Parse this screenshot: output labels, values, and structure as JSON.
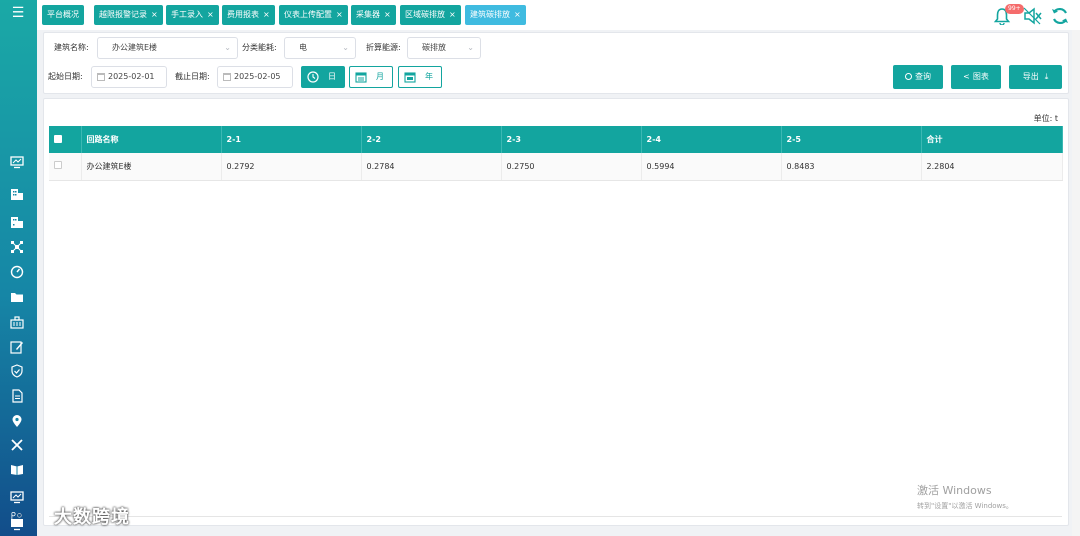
{
  "tabs": [
    {
      "label": "平台概况",
      "closable": false
    },
    {
      "label": "越限报警记录",
      "closable": true
    },
    {
      "label": "手工录入",
      "closable": true
    },
    {
      "label": "费用报表",
      "closable": true
    },
    {
      "label": "仪表上传配置",
      "closable": true
    },
    {
      "label": "采集器",
      "closable": true
    },
    {
      "label": "区域碳排放",
      "closable": true
    },
    {
      "label": "建筑碳排放",
      "closable": true,
      "active": true
    }
  ],
  "close_glyph": "×",
  "notifications": {
    "badge": "99+"
  },
  "filters": {
    "building_label": "建筑名称:",
    "building_value": "办公建筑E楼",
    "category_label": "分类能耗:",
    "category_value": "电",
    "convert_label": "折算能源:",
    "convert_value": "碳排放",
    "start_label": "起始日期:",
    "start_value": "2025-02-01",
    "end_label": "截止日期:",
    "end_value": "2025-02-05",
    "mode_day": "日",
    "mode_month": "月",
    "mode_year": "年"
  },
  "buttons": {
    "query": "查询",
    "chart": "图表",
    "export": "导出"
  },
  "unit_label": "单位: t",
  "table": {
    "headers": [
      "回路名称",
      "2-1",
      "2-2",
      "2-3",
      "2-4",
      "2-5",
      "合计"
    ],
    "rows": [
      [
        "办公建筑E楼",
        "0.2792",
        "0.2784",
        "0.2750",
        "0.5994",
        "0.8483",
        "2.2804"
      ]
    ]
  },
  "watermark": {
    "line1": "激活 Windows",
    "line2": "转到\"设置\"以激活 Windows。"
  },
  "logo_text": "大数跨境",
  "colors": {
    "primary": "#13a59f",
    "active_tab": "#3fbbe0",
    "badge": "#f56c6c"
  },
  "sidebar_icons": [
    "monitor-icon",
    "building-icon",
    "buildings-icon",
    "network-icon",
    "dashboard-icon",
    "folder-icon",
    "city-icon",
    "edit-icon",
    "shield-icon",
    "document-icon",
    "location-icon",
    "tools-icon",
    "book-icon",
    "screen-icon",
    "settings-screen-icon"
  ]
}
